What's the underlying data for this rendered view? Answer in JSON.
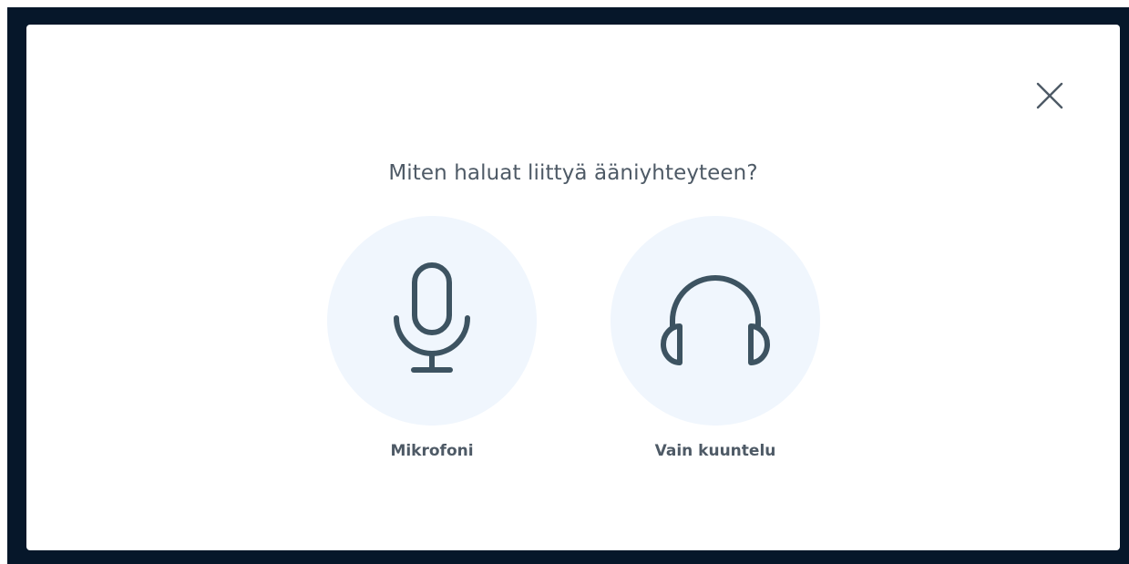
{
  "dialog": {
    "title": "Miten haluat liittyä ääniyhteyteen?",
    "close_icon": "close-icon",
    "options": [
      {
        "label": "Mikrofoni",
        "icon": "microphone-icon"
      },
      {
        "label": "Vain kuuntelu",
        "icon": "headphones-icon"
      }
    ]
  },
  "colors": {
    "backdrop": "#06172a",
    "modal": "#ffffff",
    "text": "#4e5a66",
    "option_circle": "#f0f6fd",
    "icon_stroke": "#3d5361"
  }
}
